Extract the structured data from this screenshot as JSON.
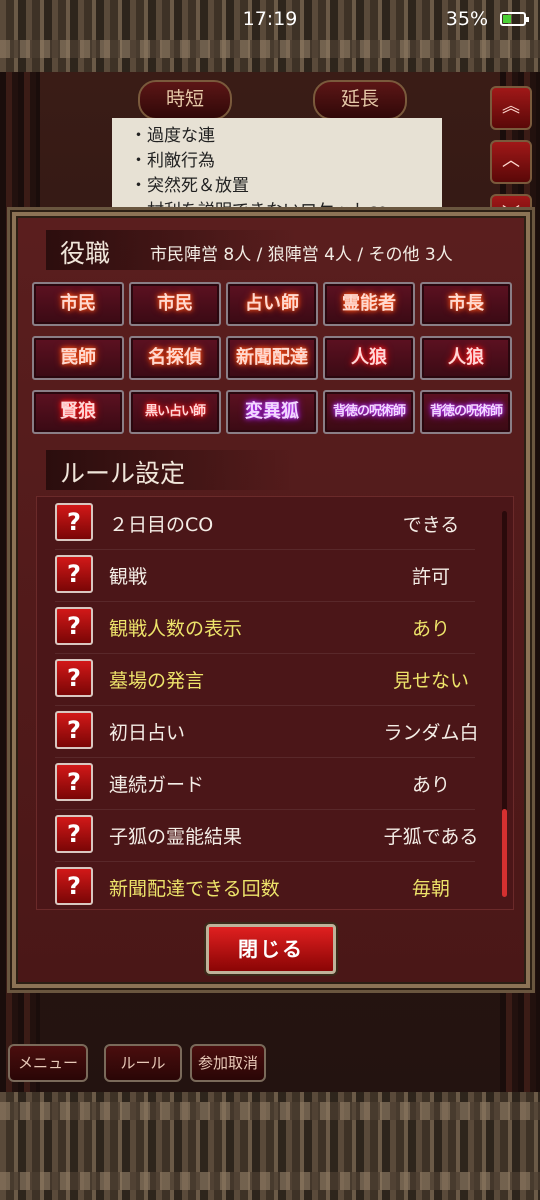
{
  "status_bar": {
    "time": "17:19",
    "battery": "35%"
  },
  "background": {
    "jitan": "時短",
    "encho": "延長",
    "notes": [
      "・過度な連",
      "・利敵行為",
      "・突然死＆放置",
      "・村利を説明できないロケットco"
    ]
  },
  "roles": {
    "title": "役職",
    "summary": "市民陣営 8人 / 狼陣営 4人 / その他 3人",
    "items": [
      {
        "label": "市民"
      },
      {
        "label": "市民"
      },
      {
        "label": "占い師"
      },
      {
        "label": "霊能者"
      },
      {
        "label": "市長"
      },
      {
        "label": "罠師"
      },
      {
        "label": "名探偵"
      },
      {
        "label": "新聞配達"
      },
      {
        "label": "人狼"
      },
      {
        "label": "人狼"
      },
      {
        "label": "賢狼"
      },
      {
        "label": "黒い占い師"
      },
      {
        "label": "変異狐"
      },
      {
        "label": "背徳の呪術師"
      },
      {
        "label": "背徳の呪術師"
      }
    ]
  },
  "rules": {
    "title": "ルール設定",
    "items": [
      {
        "label": "２日目のCO",
        "value": "できる"
      },
      {
        "label": "観戦",
        "value": "許可"
      },
      {
        "label": "観戦人数の表示",
        "value": "あり"
      },
      {
        "label": "墓場の発言",
        "value": "見せない"
      },
      {
        "label": "初日占い",
        "value": "ランダム白"
      },
      {
        "label": "連続ガード",
        "value": "あり"
      },
      {
        "label": "子狐の霊能結果",
        "value": "子狐である"
      },
      {
        "label": "新聞配達できる回数",
        "value": "毎朝"
      }
    ],
    "help_icon": "?",
    "scroll_position": 0.8
  },
  "close_label": "閉じる",
  "bottom_bar": {
    "menu": "メニュー",
    "rule": "ルール",
    "cancel": "参加取消"
  },
  "colors": {
    "panel": "#4a1717",
    "frame": "#8c7355",
    "highlight": "#ede36a",
    "accent": "#d21818"
  }
}
